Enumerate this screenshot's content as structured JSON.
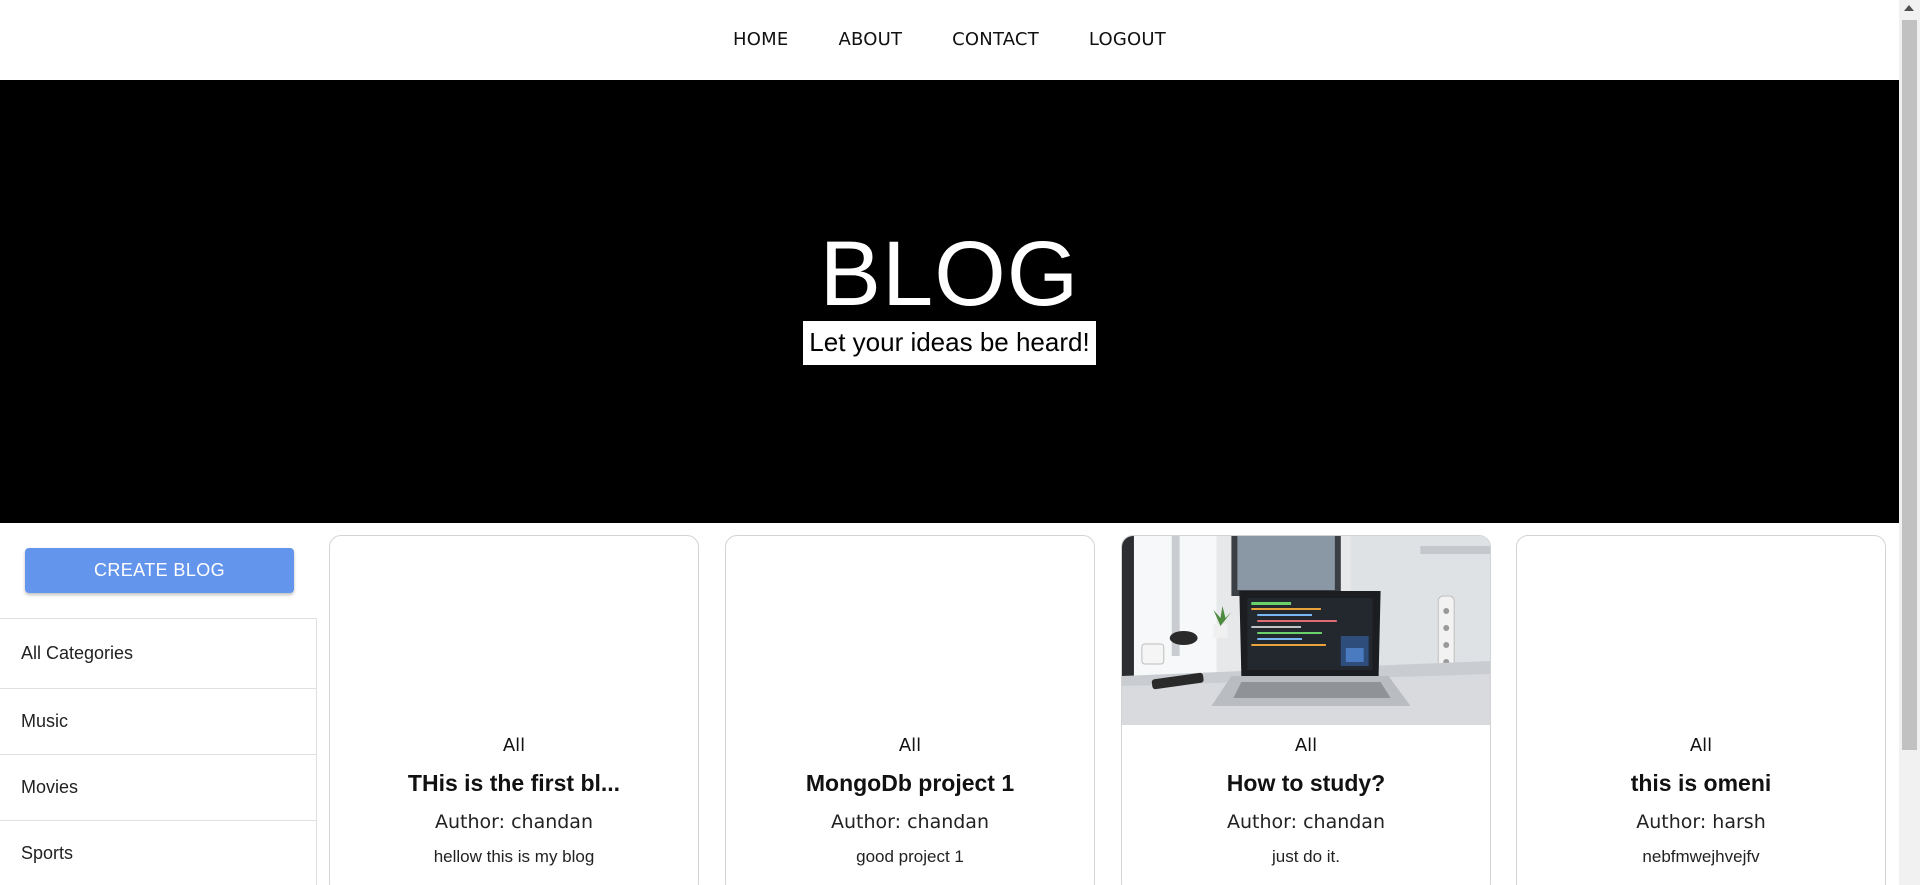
{
  "nav": {
    "items": [
      {
        "label": "HOME"
      },
      {
        "label": "ABOUT"
      },
      {
        "label": "CONTACT"
      },
      {
        "label": "LOGOUT"
      }
    ]
  },
  "hero": {
    "title": "BLOG",
    "subtitle": "Let your ideas be heard!"
  },
  "sidebar": {
    "create_label": "CREATE BLOG",
    "categories": [
      {
        "label": "All Categories"
      },
      {
        "label": "Music"
      },
      {
        "label": "Movies"
      },
      {
        "label": "Sports"
      }
    ]
  },
  "posts": [
    {
      "category": "All",
      "title": "THis is the first bl...",
      "author": "Author: chandan",
      "description": "hellow this is my blog",
      "has_image": false
    },
    {
      "category": "All",
      "title": "MongoDb project 1",
      "author": "Author: chandan",
      "description": "good project 1",
      "has_image": false
    },
    {
      "category": "All",
      "title": "How to study?",
      "author": "Author: chandan",
      "description": "just do it.",
      "has_image": true,
      "image_icon": "laptop-desk-photo"
    },
    {
      "category": "All",
      "title": "this is omeni",
      "author": "Author: harsh",
      "description": "nebfmwejhvejfv",
      "has_image": false
    }
  ],
  "colors": {
    "hero_bg": "#000000",
    "create_button": "#6495ed"
  }
}
